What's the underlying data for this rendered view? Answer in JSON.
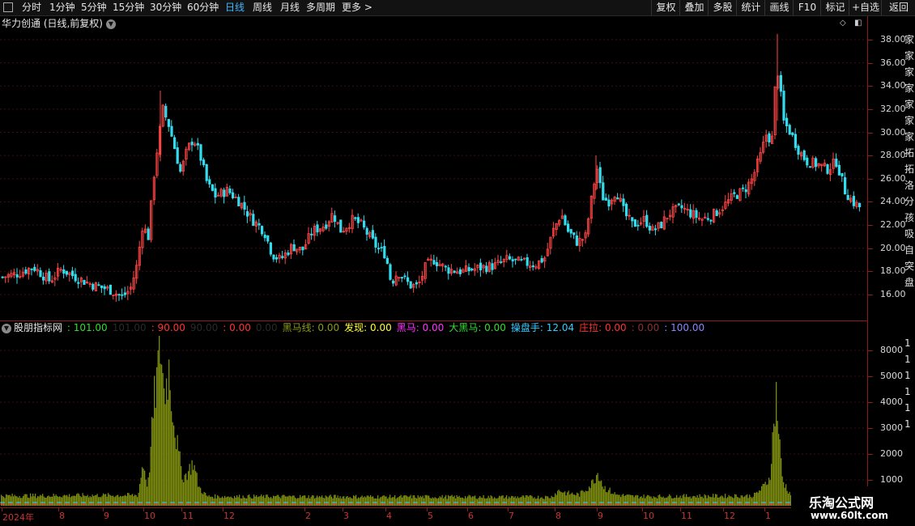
{
  "toolbar": {
    "periods": [
      "分时",
      "1分钟",
      "5分钟",
      "15分钟",
      "30分钟",
      "60分钟",
      "日线",
      "周线",
      "月线",
      "多周期",
      "更多 >"
    ],
    "actions": [
      "复权",
      "叠加",
      "多股",
      "统计",
      "画线",
      "F10",
      "标记",
      "+自选",
      "返回"
    ]
  },
  "main_title": "华力创通 (日线,前复权)",
  "price_axis": [
    "38.00",
    "36.00",
    "34.00",
    "32.00",
    "30.00",
    "28.00",
    "26.00",
    "24.00",
    "22.00",
    "20.00",
    "18.00",
    "16.00"
  ],
  "volume_axis": [
    "8000",
    "5000",
    "4000",
    "3000",
    "2000",
    "1000"
  ],
  "indicator": {
    "name": "股朋指标网",
    "values": [
      {
        "label": "",
        "value": ": 101.00",
        "color": "#33dd33"
      },
      {
        "label": "",
        "value": "101.00",
        "color": "#2a2a2a"
      },
      {
        "label": "",
        "value": ": 90.00",
        "color": "#ff3333"
      },
      {
        "label": "",
        "value": "90.00",
        "color": "#2a2a2a"
      },
      {
        "label": "",
        "value": ": 0.00",
        "color": "#ff3333"
      },
      {
        "label": "",
        "value": "0.00",
        "color": "#2a2a2a"
      },
      {
        "label": "黑马线",
        "value": ": 0.00",
        "color": "#8a9a1a"
      },
      {
        "label": "发现",
        "value": ": 0.00",
        "color": "#ffff33"
      },
      {
        "label": "黑马",
        "value": ": 0.00",
        "color": "#ff33ff"
      },
      {
        "label": "大黑马",
        "value": ": 0.00",
        "color": "#33dd33"
      },
      {
        "label": "操盘手",
        "value": ": 12.04",
        "color": "#33ccff"
      },
      {
        "label": "庄拉",
        "value": ": 0.00",
        "color": "#ff3333"
      },
      {
        "label": "",
        "value": ": 0.00",
        "color": "#883333"
      },
      {
        "label": "",
        "value": ": 100.00",
        "color": "#8888ff"
      }
    ]
  },
  "x_axis": [
    "2024年",
    "8",
    "9",
    "10",
    "11",
    "12",
    "2",
    "3",
    "4",
    "5",
    "6",
    "7",
    "8",
    "9",
    "10",
    "11",
    "12",
    "1"
  ],
  "right_strip": [
    "家",
    "家",
    "家",
    "家",
    "家",
    "家",
    "家",
    "拓",
    "拓",
    "洛",
    "分",
    "孩",
    "吸",
    "自",
    "突",
    "盘",
    "1",
    "1",
    "1",
    "1",
    "1",
    "1"
  ],
  "watermark": {
    "title": "乐淘公式网",
    "url": "www.60lt.com"
  },
  "colors": {
    "up": "#ff4444",
    "down": "#33ddee",
    "volume": "#7a8a10",
    "axis": "#8c1c1c"
  },
  "chart_data": {
    "type": "candlestick",
    "title": "华力创通 (日线,前复权)",
    "ylim": [
      15,
      39
    ],
    "close_profile": [
      [
        0,
        17.5
      ],
      [
        20,
        17.8
      ],
      [
        40,
        18.4
      ],
      [
        60,
        17.2
      ],
      [
        75,
        18.2
      ],
      [
        95,
        17.4
      ],
      [
        115,
        16.8
      ],
      [
        135,
        16.4
      ],
      [
        150,
        15.8
      ],
      [
        160,
        16.5
      ],
      [
        168,
        18.5
      ],
      [
        175,
        22
      ],
      [
        182,
        21
      ],
      [
        190,
        27
      ],
      [
        200,
        32
      ],
      [
        208,
        30.5
      ],
      [
        215,
        28.5
      ],
      [
        222,
        26.5
      ],
      [
        230,
        28.5
      ],
      [
        238,
        29.5
      ],
      [
        246,
        28
      ],
      [
        255,
        25.5
      ],
      [
        265,
        24.5
      ],
      [
        280,
        25
      ],
      [
        295,
        24
      ],
      [
        310,
        22.5
      ],
      [
        325,
        21.5
      ],
      [
        335,
        19.5
      ],
      [
        345,
        19
      ],
      [
        360,
        20.2
      ],
      [
        372,
        19.8
      ],
      [
        385,
        21.5
      ],
      [
        400,
        22
      ],
      [
        410,
        23
      ],
      [
        420,
        21.5
      ],
      [
        435,
        22.5
      ],
      [
        445,
        22
      ],
      [
        455,
        21
      ],
      [
        465,
        20
      ],
      [
        475,
        19.5
      ],
      [
        482,
        17
      ],
      [
        490,
        18
      ],
      [
        505,
        16.8
      ],
      [
        515,
        16.7
      ],
      [
        525,
        18.5
      ],
      [
        535,
        19
      ],
      [
        550,
        18.2
      ],
      [
        570,
        18
      ],
      [
        590,
        18.3
      ],
      [
        610,
        18.5
      ],
      [
        625,
        19
      ],
      [
        640,
        18.8
      ],
      [
        660,
        18.6
      ],
      [
        672,
        19.2
      ],
      [
        682,
        21.5
      ],
      [
        692,
        23
      ],
      [
        700,
        21.5
      ],
      [
        712,
        20.5
      ],
      [
        722,
        21
      ],
      [
        730,
        24.5
      ],
      [
        736,
        27
      ],
      [
        742,
        24.5
      ],
      [
        750,
        24
      ],
      [
        760,
        25
      ],
      [
        770,
        23
      ],
      [
        780,
        22
      ],
      [
        795,
        22.5
      ],
      [
        805,
        21.5
      ],
      [
        815,
        22
      ],
      [
        825,
        23
      ],
      [
        840,
        23.5
      ],
      [
        852,
        23
      ],
      [
        865,
        22.5
      ],
      [
        878,
        22.8
      ],
      [
        890,
        23.5
      ],
      [
        905,
        24.5
      ],
      [
        918,
        25
      ],
      [
        928,
        26
      ],
      [
        938,
        28
      ],
      [
        946,
        30
      ],
      [
        952,
        29
      ],
      [
        958,
        36
      ],
      [
        962,
        34
      ],
      [
        966,
        31
      ],
      [
        975,
        30
      ],
      [
        985,
        28.5
      ],
      [
        995,
        27.5
      ],
      [
        1010,
        27.2
      ],
      [
        1020,
        26.8
      ],
      [
        1032,
        27.5
      ],
      [
        1042,
        25
      ],
      [
        1052,
        24
      ],
      [
        1062,
        23.5
      ]
    ],
    "volume_profile": [
      [
        0,
        1.6
      ],
      [
        170,
        1.7
      ],
      [
        176,
        7
      ],
      [
        182,
        3
      ],
      [
        190,
        17
      ],
      [
        198,
        26
      ],
      [
        202,
        18
      ],
      [
        208,
        22
      ],
      [
        214,
        14
      ],
      [
        220,
        8
      ],
      [
        226,
        4.5
      ],
      [
        232,
        5.5
      ],
      [
        238,
        7
      ],
      [
        245,
        3
      ],
      [
        255,
        1.5
      ],
      [
        680,
        1.4
      ],
      [
        690,
        2.5
      ],
      [
        700,
        2
      ],
      [
        715,
        1.8
      ],
      [
        730,
        3.5
      ],
      [
        738,
        5.5
      ],
      [
        745,
        3
      ],
      [
        760,
        1.8
      ],
      [
        780,
        1.5
      ],
      [
        930,
        1.6
      ],
      [
        942,
        3
      ],
      [
        950,
        4.5
      ],
      [
        958,
        18
      ],
      [
        962,
        10
      ],
      [
        966,
        4
      ],
      [
        975,
        2
      ],
      [
        980,
        1.5
      ]
    ]
  }
}
